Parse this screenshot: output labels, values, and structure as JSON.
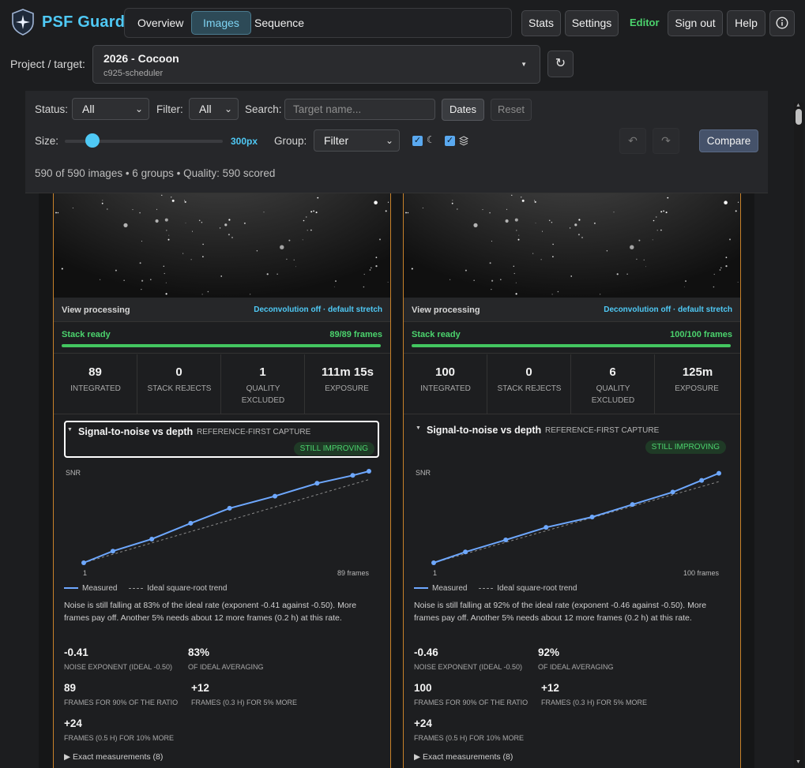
{
  "app": {
    "brand": "PSF Guard"
  },
  "nav": {
    "tabs": [
      "Overview",
      "Images",
      "Sequence"
    ],
    "active": "Images"
  },
  "header_buttons": {
    "stats": "Stats",
    "settings": "Settings",
    "editor": "Editor",
    "signout": "Sign out",
    "help": "Help",
    "info_icon": "info-icon"
  },
  "colors": {
    "accent": "#4fc9f5",
    "green": "#4bd36d",
    "card_border": "#c7812a",
    "measured_line": "#6ea8ff"
  },
  "project": {
    "label": "Project / target:",
    "name": "2026 - Cocoon",
    "profile": "c925-scheduler"
  },
  "filters": {
    "status_label": "Status:",
    "status_value": "All",
    "filter_label": "Filter:",
    "filter_value": "All",
    "search_label": "Search:",
    "search_placeholder": "Target name...",
    "dates": "Dates",
    "reset": "Reset",
    "size_label": "Size:",
    "size_value": "300px",
    "group_label": "Group:",
    "group_value": "Filter",
    "compare": "Compare",
    "summary": "590 of 590 images • 6 groups • Quality: 590 scored"
  },
  "cards": [
    {
      "processing": "View processing",
      "processing_mode": "Deconvolution off · default stretch",
      "stack_status": "Stack ready",
      "stack_frames": "89/89 frames",
      "stack_progress": 1.0,
      "stats": [
        {
          "value": "89",
          "label": "INTEGRATED"
        },
        {
          "value": "0",
          "label": "STACK REJECTS"
        },
        {
          "value": "1",
          "label": "QUALITY EXCLUDED"
        },
        {
          "value": "111m 15s",
          "label": "EXPOSURE"
        }
      ],
      "snr": {
        "title": "Signal-to-noise vs depth",
        "subtitle": "REFERENCE-FIRST CAPTURE",
        "badge": "STILL IMPROVING",
        "ylabel": "SNR",
        "x_start": "1",
        "x_end": "89 frames",
        "legend_measured": "Measured",
        "legend_ideal": "Ideal square-root trend",
        "description": "Noise is still falling at 83% of the ideal rate (exponent -0.41 against -0.50). More frames pay off. Another 5% needs about 12 more frames (0.2 h) at this rate.",
        "metrics": [
          {
            "value": "-0.41",
            "label": "NOISE EXPONENT (IDEAL -0.50)"
          },
          {
            "value": "83%",
            "label": "OF IDEAL AVERAGING"
          },
          {
            "value": "89",
            "label": "FRAMES FOR 90% OF THE RATIO"
          },
          {
            "value": "+12",
            "label": "FRAMES (0.3 H) FOR 5% MORE"
          },
          {
            "value": "+24",
            "label": "FRAMES (0.5 H) FOR 10% MORE"
          }
        ],
        "exact": "Exact measurements (8)"
      }
    },
    {
      "processing": "View processing",
      "processing_mode": "Deconvolution off · default stretch",
      "stack_status": "Stack ready",
      "stack_frames": "100/100 frames",
      "stack_progress": 1.0,
      "stats": [
        {
          "value": "100",
          "label": "INTEGRATED"
        },
        {
          "value": "0",
          "label": "STACK REJECTS"
        },
        {
          "value": "6",
          "label": "QUALITY EXCLUDED"
        },
        {
          "value": "125m",
          "label": "EXPOSURE"
        }
      ],
      "snr": {
        "title": "Signal-to-noise vs depth",
        "subtitle": "REFERENCE-FIRST CAPTURE",
        "badge": "STILL IMPROVING",
        "ylabel": "SNR",
        "x_start": "1",
        "x_end": "100 frames",
        "legend_measured": "Measured",
        "legend_ideal": "Ideal square-root trend",
        "description": "Noise is still falling at 92% of the ideal rate (exponent -0.46 against -0.50). More frames pay off. Another 5% needs about 12 more frames (0.2 h) at this rate.",
        "metrics": [
          {
            "value": "-0.46",
            "label": "NOISE EXPONENT (IDEAL -0.50)"
          },
          {
            "value": "92%",
            "label": "OF IDEAL AVERAGING"
          },
          {
            "value": "100",
            "label": "FRAMES FOR 90% OF THE RATIO"
          },
          {
            "value": "+12",
            "label": "FRAMES (0.3 H) FOR 5% MORE"
          },
          {
            "value": "+24",
            "label": "FRAMES (0.5 H) FOR 10% MORE"
          }
        ],
        "exact": "Exact measurements (8)"
      }
    }
  ],
  "chart_data": [
    {
      "type": "line",
      "xlabel": "",
      "ylabel": "SNR",
      "xlim": [
        1,
        89
      ],
      "series": [
        {
          "name": "Measured",
          "x": [
            1,
            10,
            22,
            34,
            46,
            60,
            73,
            84,
            89
          ],
          "values": [
            1.0,
            1.28,
            1.57,
            1.95,
            2.31,
            2.6,
            2.91,
            3.1,
            3.2
          ]
        },
        {
          "name": "Ideal square-root trend",
          "x": [
            1,
            89
          ],
          "values": [
            1.0,
            3.0
          ]
        }
      ]
    },
    {
      "type": "line",
      "xlabel": "",
      "ylabel": "SNR",
      "xlim": [
        1,
        100
      ],
      "series": [
        {
          "name": "Measured",
          "x": [
            1,
            12,
            26,
            40,
            56,
            70,
            84,
            94,
            100
          ],
          "values": [
            1.0,
            1.26,
            1.55,
            1.85,
            2.1,
            2.4,
            2.7,
            2.98,
            3.15
          ]
        },
        {
          "name": "Ideal square-root trend",
          "x": [
            1,
            100
          ],
          "values": [
            1.0,
            2.95
          ]
        }
      ]
    }
  ]
}
